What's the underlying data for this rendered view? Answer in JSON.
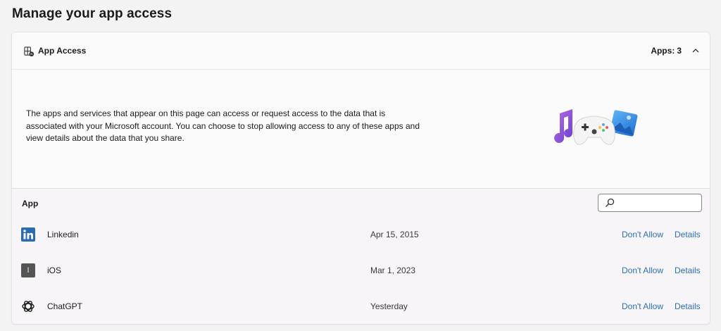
{
  "page": {
    "title": "Manage your app access"
  },
  "card": {
    "title": "App Access",
    "count_label": "Apps:",
    "count": "3",
    "icons": {
      "header": "app-access-icon",
      "collapse": "chevron-up-icon"
    }
  },
  "intro": {
    "text": "The apps and services that appear on this page can access or request access to the data that is associated with your Microsoft account. You can choose to stop allowing access to any of these apps and view details about the data that you share.",
    "illustration": "music-controller-photo-illustration"
  },
  "table": {
    "column_header": "App",
    "search": {
      "value": "",
      "placeholder": ""
    },
    "rows": [
      {
        "name": "Linkedin",
        "date": "Apr 15, 2015",
        "action": "Don't Allow",
        "details": "Details",
        "icon": "linkedin-icon",
        "icon_letter": "in",
        "color": "#2b6bb0"
      },
      {
        "name": "iOS",
        "date": "Mar 1, 2023",
        "action": "Don't Allow",
        "details": "Details",
        "icon": "ios-icon",
        "icon_letter": "I",
        "color": "#555555"
      },
      {
        "name": "ChatGPT",
        "date": "Yesterday",
        "action": "Don't Allow",
        "details": "Details",
        "icon": "chatgpt-icon",
        "color": "#1b1b1b"
      }
    ]
  },
  "colors": {
    "link": "#2d6fb8",
    "background": "#f3f3f3",
    "card": "#fbfbfb",
    "table": "#f7f5f8"
  }
}
